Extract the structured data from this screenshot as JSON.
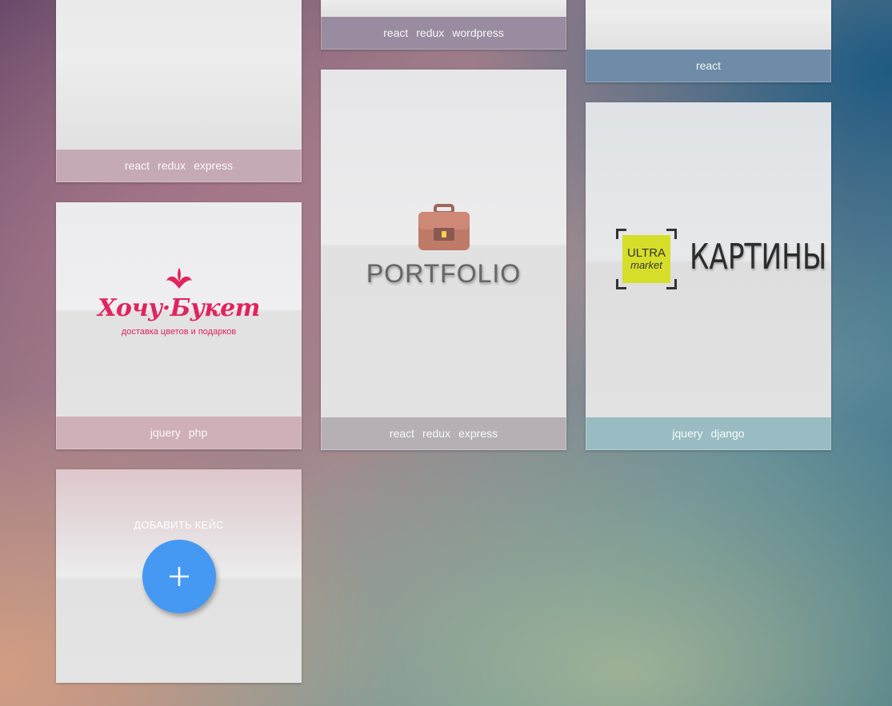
{
  "cards": [
    {
      "id": "card-1",
      "tags": [
        "react",
        "redux",
        "express"
      ]
    },
    {
      "id": "card-2",
      "tags": [
        "react",
        "redux",
        "wordpress"
      ]
    },
    {
      "id": "card-3",
      "tags": [
        "react"
      ]
    },
    {
      "id": "card-hochu",
      "logo_title": "Хочу·Букет",
      "logo_subtitle": "доставка цветов и подарков",
      "tags": [
        "jquery",
        "php"
      ]
    },
    {
      "id": "card-portfolio",
      "logo_text": "PORTFOLIO",
      "tags": [
        "react",
        "redux",
        "express"
      ]
    },
    {
      "id": "card-ultra",
      "logo_line1": "ULTRA",
      "logo_line2": "market",
      "logo_text": "КАРТИНЫ",
      "tags": [
        "jquery",
        "django"
      ]
    }
  ],
  "add_case": {
    "label": "ДОБАВИТЬ КЕЙС",
    "icon": "plus-icon",
    "button_color": "#4599f2"
  },
  "colors": {
    "hochu_brand": "#e0245e",
    "ultra_brand": "#d6de2a"
  }
}
